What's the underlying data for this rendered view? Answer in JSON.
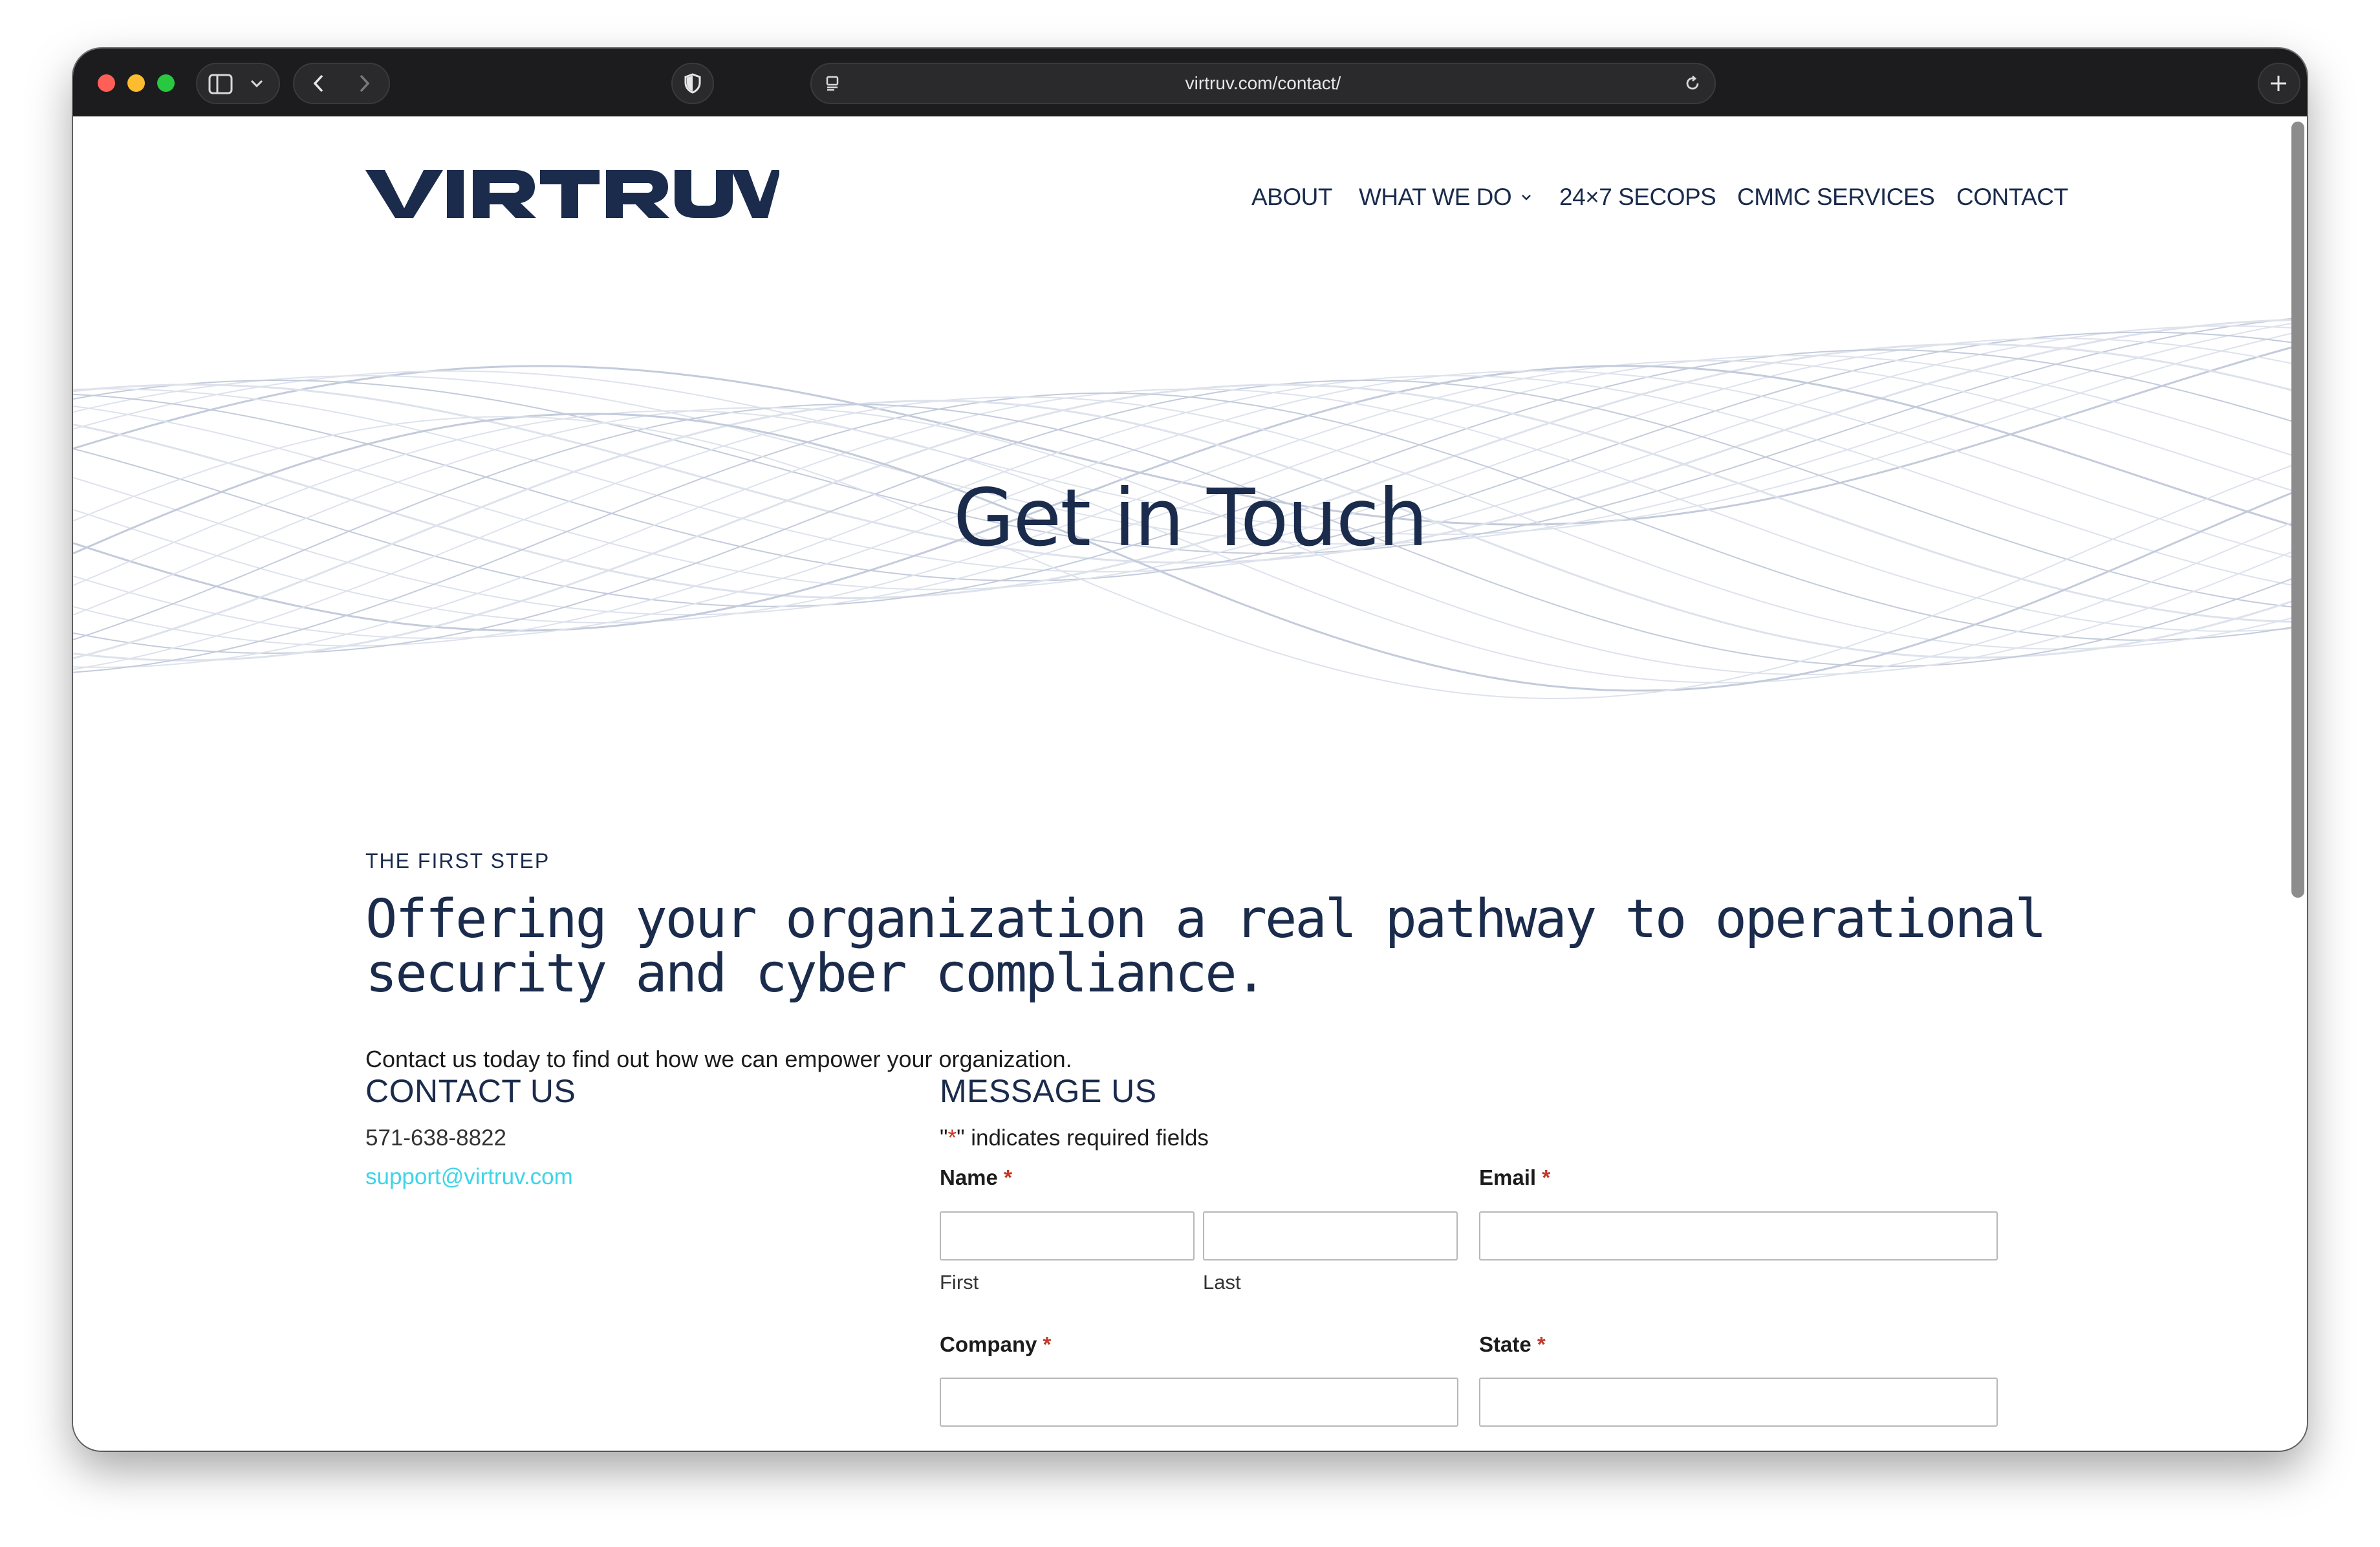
{
  "browser": {
    "url": "virtruv.com/contact/",
    "icons": [
      "sidebar-icon",
      "chevron-down-icon",
      "back-icon",
      "forward-icon",
      "shield-icon",
      "reader-icon",
      "reload-icon",
      "new-tab-icon"
    ]
  },
  "site": {
    "logo_text": "VIRTRUV",
    "nav": [
      {
        "label": "ABOUT"
      },
      {
        "label": "WHAT WE DO"
      },
      {
        "label": "24×7 SECOPS"
      },
      {
        "label": "CMMC SERVICES"
      },
      {
        "label": "CONTACT"
      }
    ]
  },
  "hero": {
    "title": "Get in Touch"
  },
  "intro": {
    "eyebrow": "THE FIRST STEP",
    "headline_line1": "Offering your organization a real pathway to operational",
    "headline_line2": "security and cyber compliance.",
    "text": "Contact us today to find out how we can empower your organization."
  },
  "contact": {
    "title": "CONTACT US",
    "phone": "571-638-8822",
    "email": "support@virtruv.com"
  },
  "form": {
    "title": "MESSAGE US",
    "required_note_prefix": "\"",
    "required_note_star": "*",
    "required_note_suffix": "\" indicates required fields",
    "required_marker": "*",
    "name_label": "Name",
    "first_label": "First",
    "last_label": "Last",
    "email_label": "Email",
    "company_label": "Company",
    "state_label": "State",
    "values": {
      "first": "",
      "last": "",
      "email": "",
      "company": "",
      "state": ""
    }
  },
  "colors": {
    "brand_navy": "#1a2b4c",
    "link_cyan": "#3ed4e8",
    "required_red": "#c0392b"
  }
}
